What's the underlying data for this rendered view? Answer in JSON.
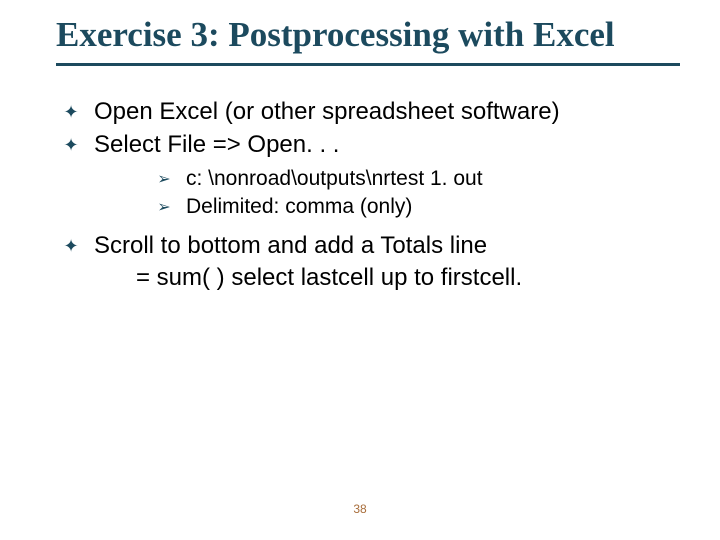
{
  "title": "Exercise 3:  Postprocessing with Excel",
  "bullets": [
    "Open Excel (or other spreadsheet software)",
    "Select File => Open. . ."
  ],
  "sub_bullets": [
    "c: \\nonroad\\outputs\\nrtest 1. out",
    "Delimited:  comma (only)"
  ],
  "bullet_tail": {
    "line1": "Scroll to bottom and add a Totals line",
    "line2": " = sum( )  select lastcell up to firstcell."
  },
  "page_number": "38"
}
